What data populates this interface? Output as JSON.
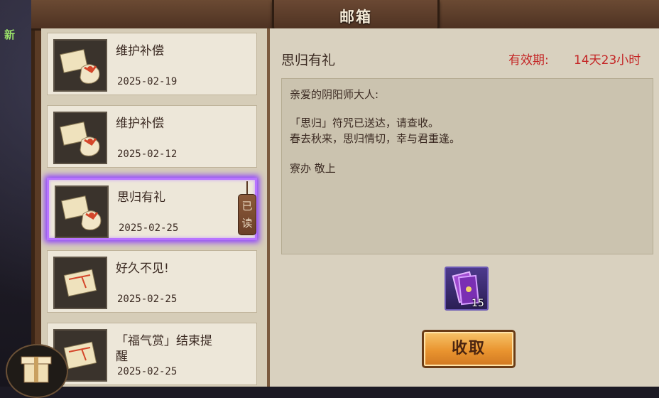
{
  "window": {
    "title": "邮箱"
  },
  "sidebar": {
    "new_badge": "新"
  },
  "mails": [
    {
      "title": "维护补偿",
      "date": "2025-02-19",
      "icon": "package-letter-icon"
    },
    {
      "title": "维护补偿",
      "date": "2025-02-12",
      "icon": "package-letter-icon"
    },
    {
      "title": "思归有礼",
      "date": "2025-02-25",
      "icon": "package-letter-icon",
      "selected": true,
      "read_tag": "已读"
    },
    {
      "title": "好久不见!",
      "date": "2025-02-25",
      "icon": "letter-icon"
    },
    {
      "title": "「福气赏」结束提醒",
      "date": "2025-02-25",
      "icon": "letter-icon"
    }
  ],
  "detail": {
    "subject": "思归有礼",
    "expiry_label": "有效期:",
    "expiry_value": "14天23小时",
    "body": [
      "亲爱的阴阳师大人:",
      "「思归」符咒已送达，请查收。",
      "春去秋来，思归情切，幸与君重逢。",
      "寮办 敬上"
    ],
    "reward": {
      "icon": "talisman-scroll-icon",
      "count": "15"
    },
    "claim_label": "收取"
  },
  "colors": {
    "expiry": "#c42424",
    "selection": "#8a3cff",
    "button": "#e9942f"
  }
}
